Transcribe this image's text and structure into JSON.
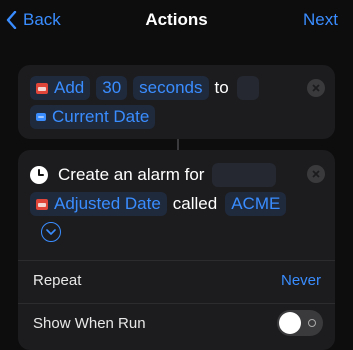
{
  "nav": {
    "back_label": "Back",
    "title": "Actions",
    "next_label": "Next"
  },
  "action1": {
    "verb": "Add",
    "amount": "30",
    "unit": "seconds",
    "preposition": "to",
    "target": "Current Date"
  },
  "action2": {
    "label": "Create an alarm for",
    "date_token": "Adjusted Date",
    "called": "called",
    "name_token": "ACME"
  },
  "settings": {
    "repeat_label": "Repeat",
    "repeat_value": "Never",
    "show_when_run_label": "Show When Run",
    "show_when_run": false
  },
  "colors": {
    "accent": "#3a8dff",
    "card": "#1c1c1e",
    "background": "#0d0d0e"
  }
}
